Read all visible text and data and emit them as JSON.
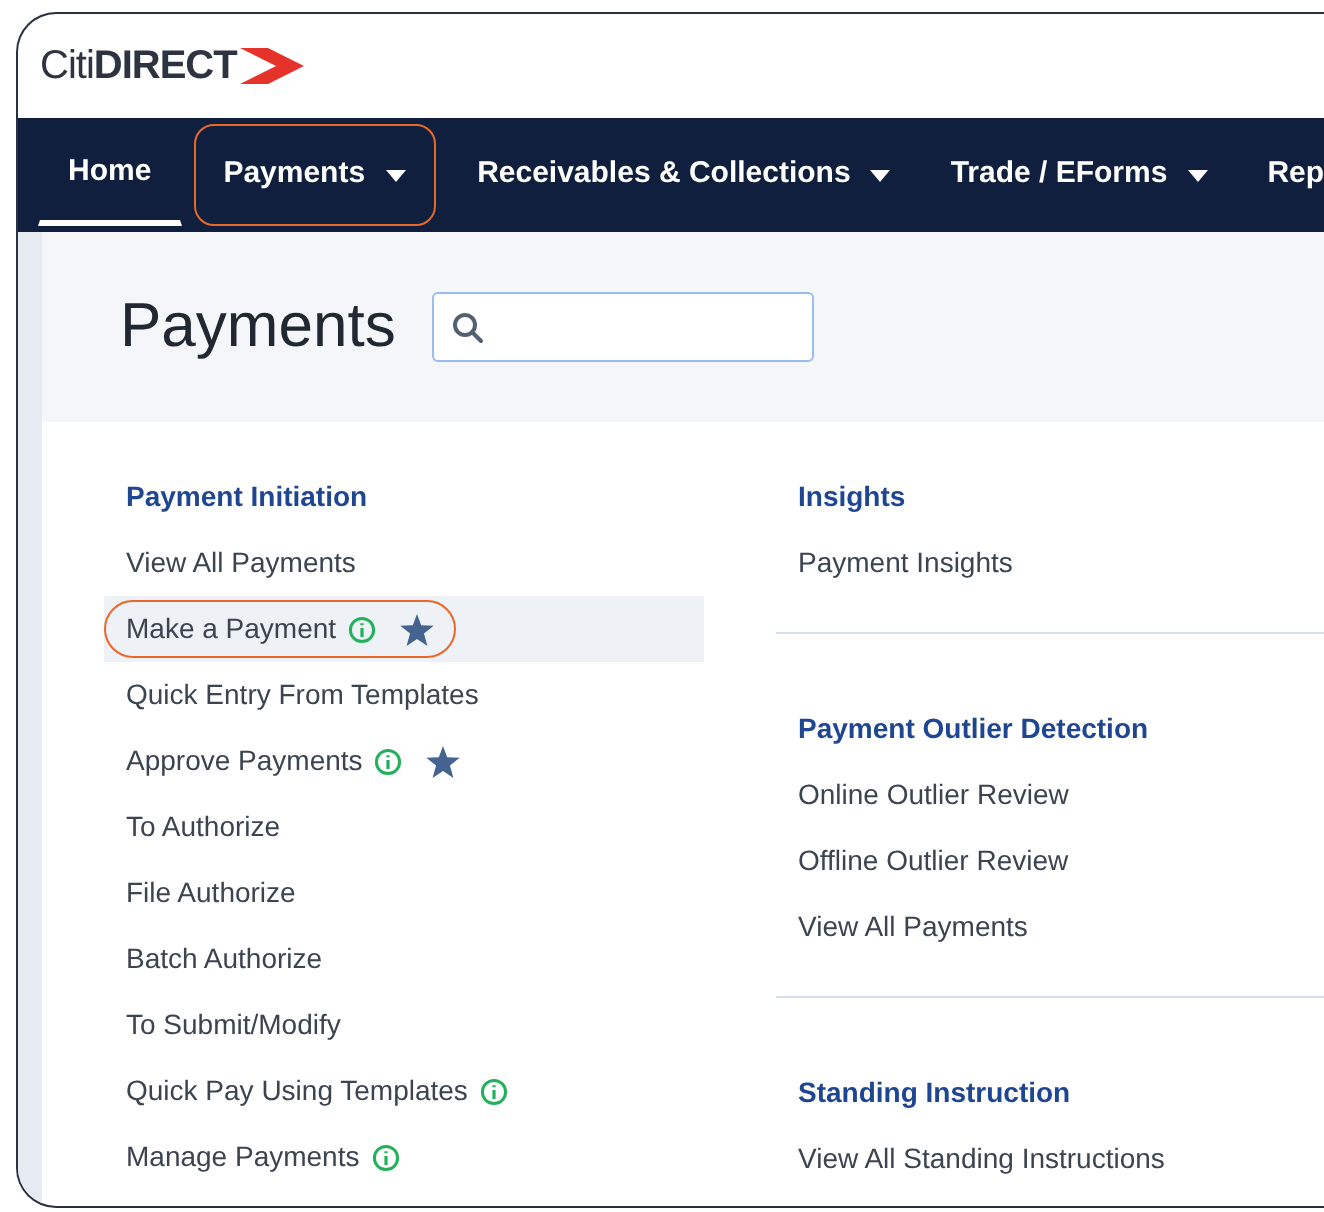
{
  "logo": {
    "text": "Citi**DIRECT**"
  },
  "nav": [
    {
      "label": "Home",
      "selected": true,
      "dropdown": false,
      "outlined": false
    },
    {
      "label": "Payments",
      "selected": false,
      "dropdown": true,
      "outlined": true
    },
    {
      "label": "Receivables & Collections",
      "selected": false,
      "dropdown": true,
      "outlined": false
    },
    {
      "label": "Trade / EForms",
      "selected": false,
      "dropdown": true,
      "outlined": false
    },
    {
      "label": "Rep",
      "selected": false,
      "dropdown": false,
      "outlined": false
    }
  ],
  "page": {
    "title": "Payments"
  },
  "left_column": {
    "heading": "Payment Initiation",
    "items": [
      {
        "label": "View All Payments",
        "info": false,
        "starred": false,
        "selected": false
      },
      {
        "label": "Make a Payment",
        "info": true,
        "starred": true,
        "selected": true
      },
      {
        "label": "Quick Entry From Templates",
        "info": false,
        "starred": false,
        "selected": false
      },
      {
        "label": "Approve Payments",
        "info": true,
        "starred": true,
        "selected": false
      },
      {
        "label": "To Authorize",
        "info": false,
        "starred": false,
        "selected": false
      },
      {
        "label": "File Authorize",
        "info": false,
        "starred": false,
        "selected": false
      },
      {
        "label": "Batch Authorize",
        "info": false,
        "starred": false,
        "selected": false
      },
      {
        "label": "To Submit/Modify",
        "info": false,
        "starred": false,
        "selected": false
      },
      {
        "label": "Quick Pay Using Templates",
        "info": true,
        "starred": false,
        "selected": false
      },
      {
        "label": "Manage Payments",
        "info": true,
        "starred": false,
        "selected": false
      }
    ]
  },
  "right_column": [
    {
      "heading": "Insights",
      "items": [
        "Payment Insights"
      ]
    },
    {
      "heading": "Payment Outlier Detection",
      "items": [
        "Online Outlier Review",
        "Offline Outlier Review",
        "View All Payments"
      ]
    },
    {
      "heading": "Standing Instruction",
      "items": [
        "View All Standing Instructions"
      ]
    }
  ]
}
